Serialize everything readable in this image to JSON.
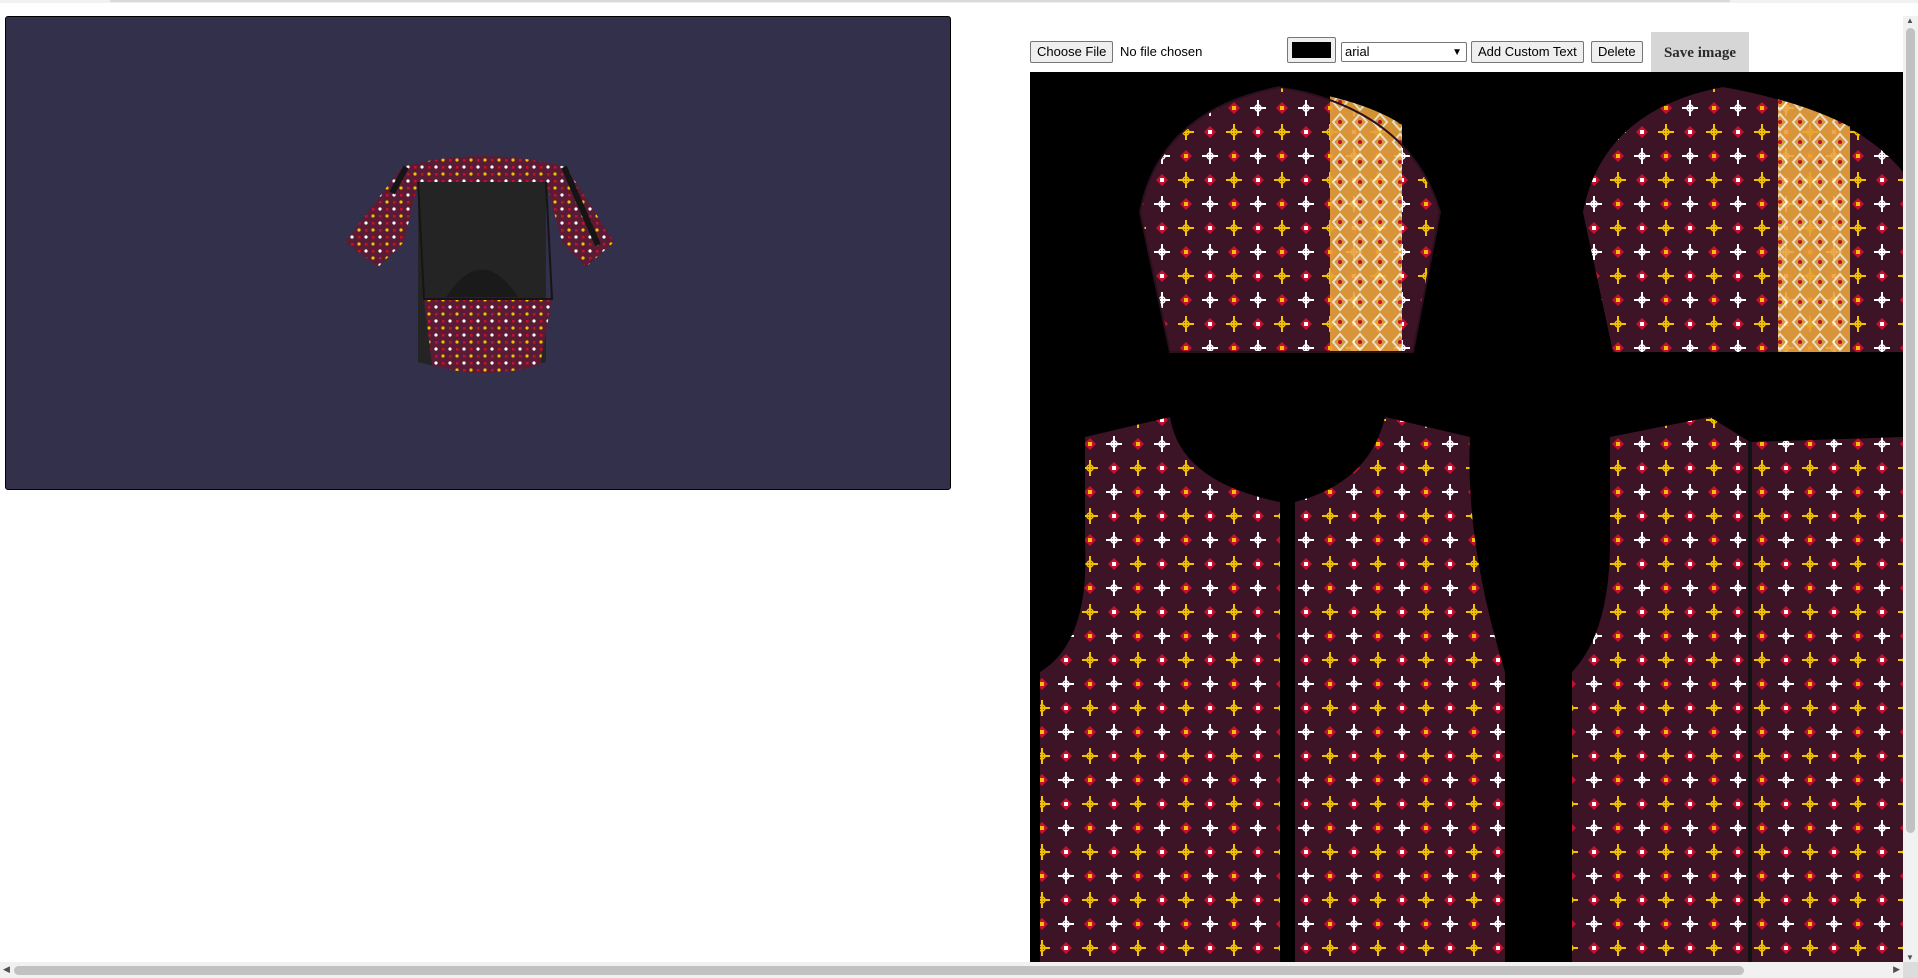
{
  "toolbar": {
    "choose_file_label": "Choose File",
    "file_status": "No file chosen",
    "text_color": "#000000",
    "font_selected": "arial",
    "add_text_label": "Add Custom Text",
    "delete_label": "Delete",
    "save_label": "Save image"
  },
  "viewer": {
    "background": "#32304a",
    "model": "t-shirt"
  },
  "canvas": {
    "background": "#000000",
    "pattern_colors": [
      "#c8102e",
      "#f2c200",
      "#ffffff",
      "#4a1730"
    ],
    "pieces": [
      "sleeve-left",
      "sleeve-right",
      "front-panel",
      "back-panel"
    ]
  }
}
